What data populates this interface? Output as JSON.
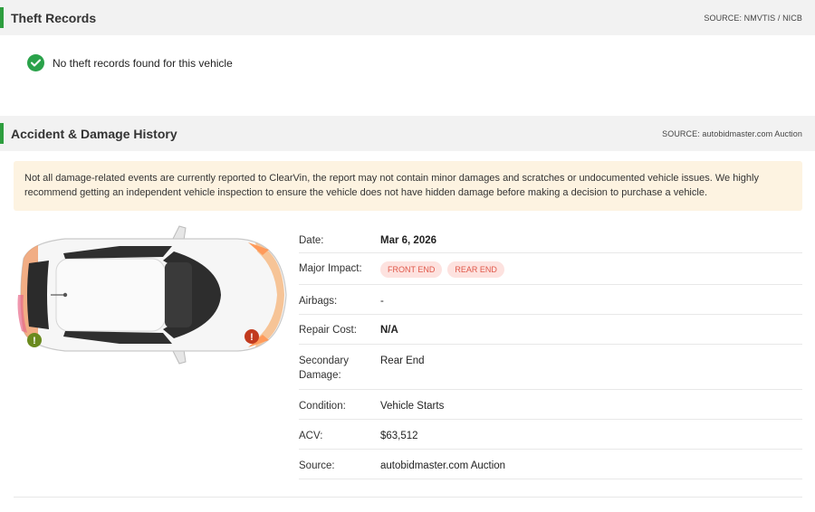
{
  "theft": {
    "title": "Theft Records",
    "source": "SOURCE: NMVTIS / NICB",
    "message": "No theft records found for this vehicle",
    "icon": "check-circle-icon",
    "icon_color": "#2aa24a"
  },
  "accident": {
    "title": "Accident & Damage History",
    "source": "SOURCE: autobidmaster.com Auction",
    "notice": "Not all damage-related events are currently reported to ClearVin, the report may not contain minor damages and scratches or undocumented vehicle issues. We highly recommend getting an independent vehicle inspection to ensure the vehicle does not have hidden damage before making a decision to purchase a vehicle.",
    "notice_bg": "#fdf3e1",
    "details": {
      "date_label": "Date:",
      "date_value": "Mar 6, 2026",
      "impact_label": "Major Impact:",
      "impact_badges": [
        "FRONT END",
        "REAR END"
      ],
      "airbags_label": "Airbags:",
      "airbags_value": "-",
      "repair_label": "Repair Cost:",
      "repair_value": "N/A",
      "secondary_label": "Secondary Damage:",
      "secondary_value": "Rear End",
      "condition_label": "Condition:",
      "condition_value": "Vehicle Starts",
      "acv_label": "ACV:",
      "acv_value": "$63,512",
      "source_label": "Source:",
      "source_value": "autobidmaster.com Auction"
    },
    "damage_markers": [
      {
        "icon": "warning-icon-green",
        "color": "#6a8a1e"
      },
      {
        "icon": "warning-icon-red",
        "color": "#c23a1e"
      }
    ]
  },
  "accent_color": "#2e9e3e"
}
